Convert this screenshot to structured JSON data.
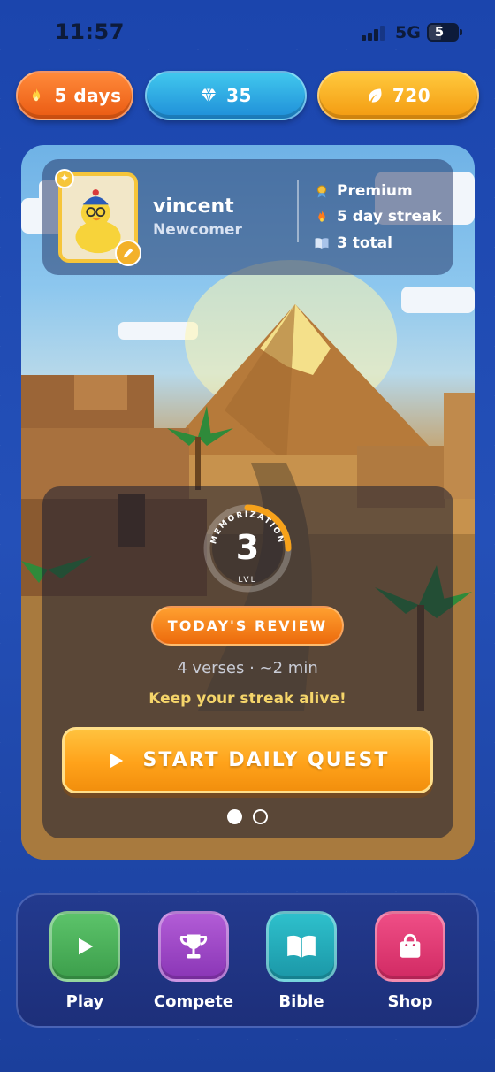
{
  "status_bar": {
    "time": "11:57",
    "network": "5G",
    "battery": "5"
  },
  "stats": {
    "streak": {
      "label": "5 days",
      "icon": "flame-icon"
    },
    "gems": {
      "label": "35",
      "icon": "diamond-icon"
    },
    "leaves": {
      "label": "720",
      "icon": "leaf-icon"
    }
  },
  "profile": {
    "username": "vincent",
    "rank": "Newcomer",
    "membership": "Premium",
    "streak": "5 day streak",
    "total": "3 total"
  },
  "quest": {
    "level_caption": "MEMORIZATION",
    "level": "3",
    "level_sub": "LVL",
    "review_label": "TODAY'S REVIEW",
    "verses": "4 verses · ~2 min",
    "message": "Keep your streak alive!",
    "start_label": "START DAILY QUEST"
  },
  "nav": [
    {
      "label": "Play",
      "icon": "play-icon"
    },
    {
      "label": "Compete",
      "icon": "trophy-icon"
    },
    {
      "label": "Bible",
      "icon": "book-icon"
    },
    {
      "label": "Shop",
      "icon": "shopping-bag-icon"
    }
  ],
  "colors": {
    "streak": "#ea5a12",
    "gems": "#1f8ed8",
    "leaves": "#f39a10",
    "cta": "#ffa21a",
    "background": "#1d47ab"
  }
}
